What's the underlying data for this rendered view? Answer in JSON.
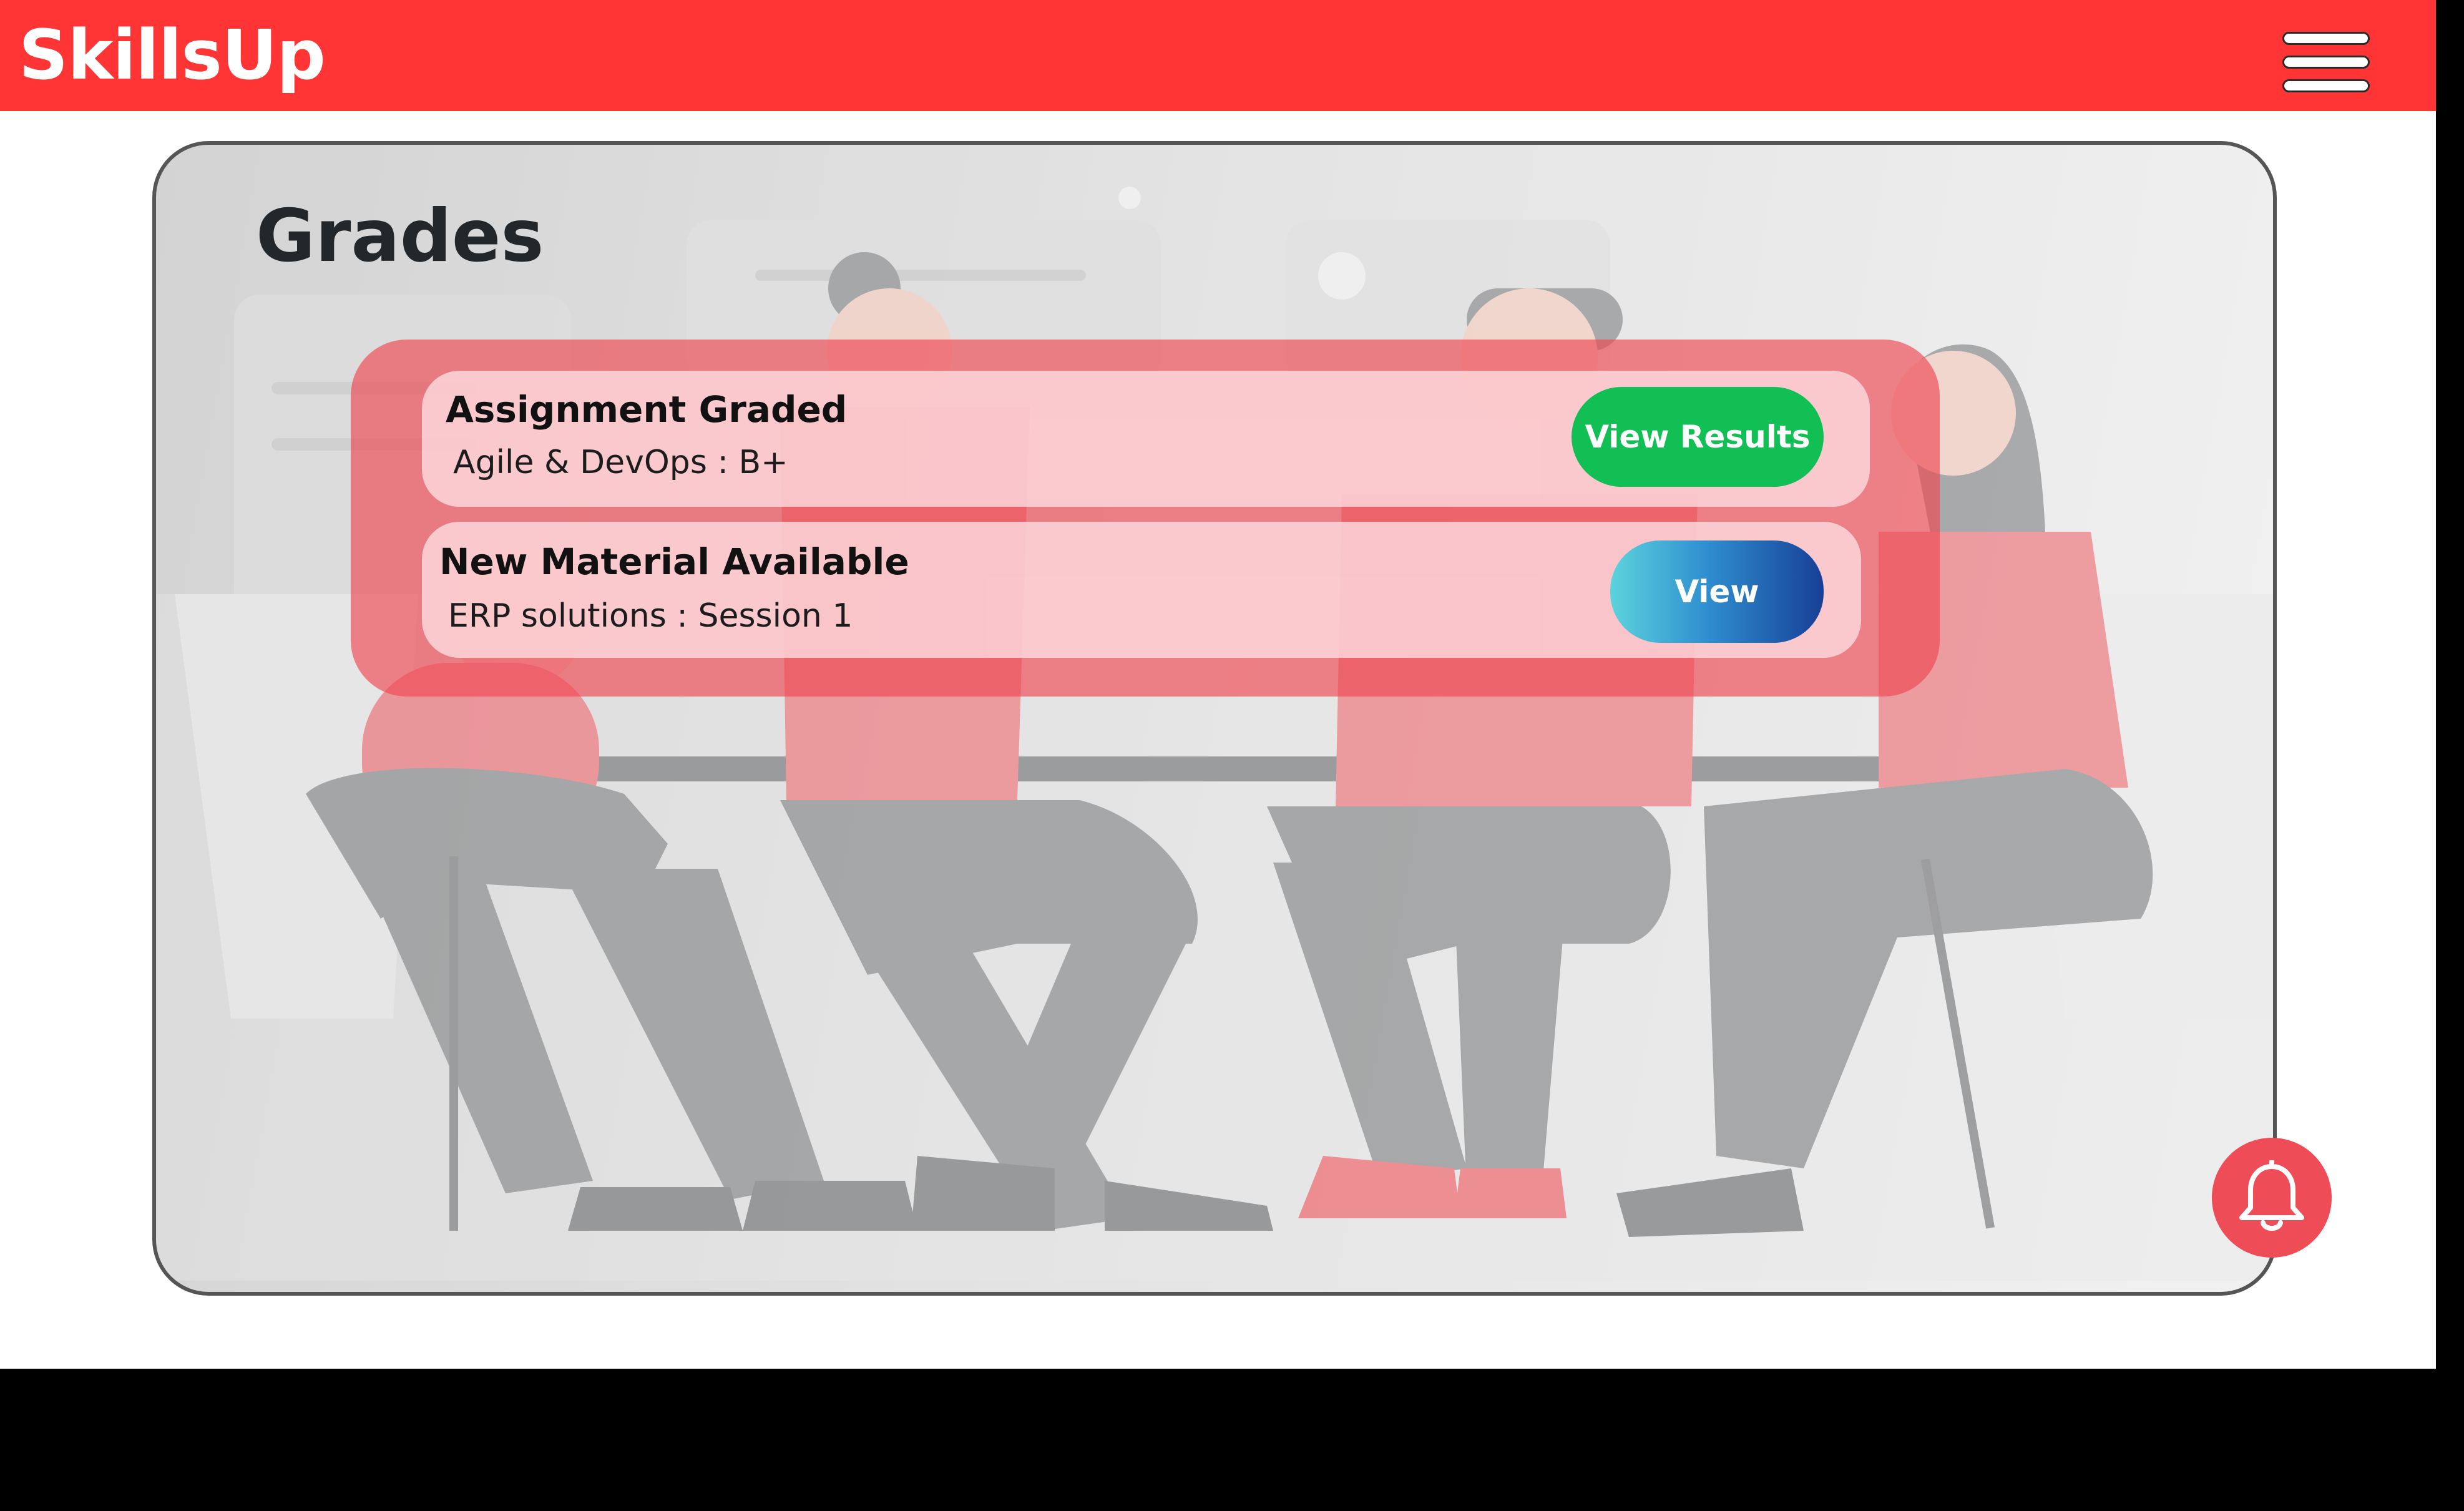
{
  "app": {
    "title": "SkillsUp"
  },
  "header": {
    "menu_icon": "hamburger-menu-icon"
  },
  "page": {
    "title": "Grades"
  },
  "notifications": [
    {
      "title": "Assignment Graded",
      "detail": "Agile & DevOps : B+",
      "action_label": "View Results",
      "action_color": "#12bf55"
    },
    {
      "title": "New Material Available",
      "detail": "ERP solutions : Session 1",
      "action_label": "View",
      "action_color": "#1f64b8"
    }
  ],
  "floating_action": {
    "icon": "bell-icon",
    "color": "#ee4d57"
  },
  "colors": {
    "brand": "#ff3535",
    "panel_border": "#555555",
    "notification_panel": "#ee4852"
  }
}
